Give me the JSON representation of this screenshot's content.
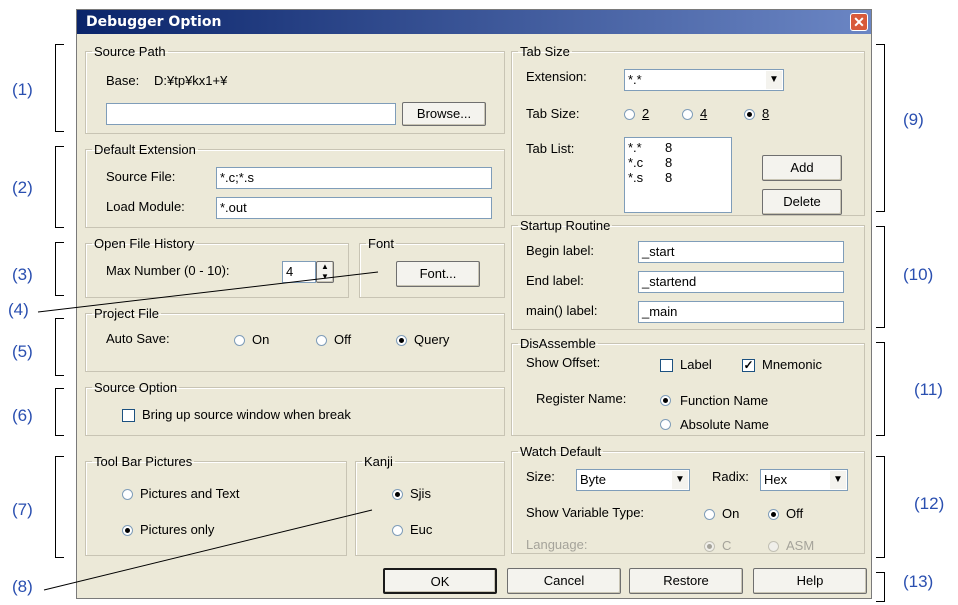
{
  "window": {
    "title": "Debugger Option",
    "close_icon": "close-icon"
  },
  "callouts": [
    "(1)",
    "(2)",
    "(3)",
    "(4)",
    "(5)",
    "(6)",
    "(7)",
    "(8)",
    "(9)",
    "(10)",
    "(11)",
    "(12)",
    "(13)"
  ],
  "source_path": {
    "legend": "Source Path",
    "base_label": "Base:",
    "base_value": "D:¥tp¥kx1+¥",
    "path_value": "",
    "browse": "Browse..."
  },
  "default_ext": {
    "legend": "Default Extension",
    "source_label": "Source File:",
    "source_value": "*.c;*.s",
    "load_label": "Load Module:",
    "load_value": "*.out"
  },
  "history": {
    "legend": "Open File History",
    "max_label": "Max Number (0 - 10):",
    "max_value": "4"
  },
  "font": {
    "legend": "Font",
    "button": "Font..."
  },
  "project": {
    "legend": "Project File",
    "auto_label": "Auto Save:",
    "options": [
      "On",
      "Off",
      "Query"
    ],
    "selected": "Query"
  },
  "source_opt": {
    "legend": "Source Option",
    "checkbox": "Bring up source window when break",
    "checked": false
  },
  "toolbar": {
    "legend": "Tool Bar Pictures",
    "options": [
      "Pictures and Text",
      "Pictures only"
    ],
    "selected": "Pictures only"
  },
  "kanji": {
    "legend": "Kanji",
    "options": [
      "Sjis",
      "Euc"
    ],
    "selected": "Sjis"
  },
  "tabsize": {
    "legend": "Tab Size",
    "ext_label": "Extension:",
    "ext_value": "*.*",
    "size_label": "Tab Size:",
    "sizes": [
      "2",
      "4",
      "8"
    ],
    "selected": "8",
    "list_label": "Tab List:",
    "list": [
      {
        "ext": "*.*",
        "size": "8"
      },
      {
        "ext": "*.c",
        "size": "8"
      },
      {
        "ext": "*.s",
        "size": "8"
      }
    ],
    "add": "Add",
    "delete": "Delete"
  },
  "startup": {
    "legend": "Startup Routine",
    "begin_label": "Begin label:",
    "begin_value": "_start",
    "end_label": "End label:",
    "end_value": "_startend",
    "main_label": "main() label:",
    "main_value": "_main"
  },
  "disasm": {
    "legend": "DisAssemble",
    "offset_label": "Show Offset:",
    "label_cb": "Label",
    "label_checked": false,
    "mnemonic_cb": "Mnemonic",
    "mnemonic_checked": true,
    "reg_label": "Register Name:",
    "reg_options": [
      "Function Name",
      "Absolute Name"
    ],
    "reg_selected": "Function Name"
  },
  "watch": {
    "legend": "Watch Default",
    "size_label": "Size:",
    "size_value": "Byte",
    "radix_label": "Radix:",
    "radix_value": "Hex",
    "vartype_label": "Show Variable Type:",
    "vartype_options": [
      "On",
      "Off"
    ],
    "vartype_selected": "Off",
    "lang_label": "Language:",
    "lang_options": [
      "C",
      "ASM"
    ],
    "lang_selected": "C"
  },
  "buttons": {
    "ok": "OK",
    "cancel": "Cancel",
    "restore": "Restore",
    "help": "Help"
  }
}
